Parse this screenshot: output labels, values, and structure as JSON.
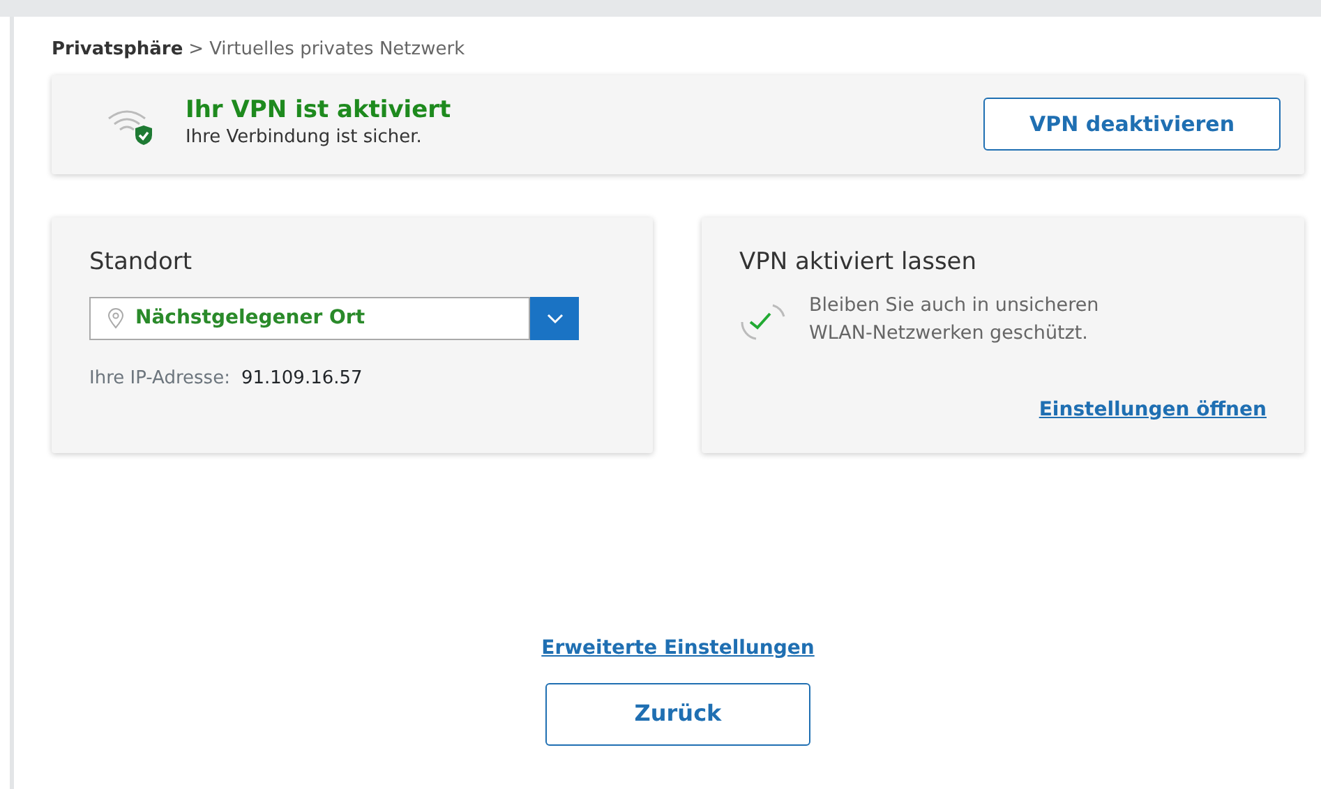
{
  "breadcrumb": {
    "parent": "Privatsphäre",
    "separator": ">",
    "current": "Virtuelles privates Netzwerk"
  },
  "status": {
    "active": true,
    "title": "Ihr VPN ist aktiviert",
    "subtitle": "Ihre Verbindung ist sicher.",
    "button": "VPN deaktivieren"
  },
  "location": {
    "title": "Standort",
    "select_value": "Nächstgelegener Ort",
    "ip_label": "Ihre IP-Adresse:",
    "ip_value": "91.109.16.57"
  },
  "keep_on": {
    "title": "VPN aktiviert lassen",
    "text": "Bleiben Sie auch in unsicheren WLAN-Netzwerken geschützt.",
    "link": "Einstellungen öffnen"
  },
  "advanced_link": "Erweiterte Einstellungen",
  "back_button": "Zurück"
}
